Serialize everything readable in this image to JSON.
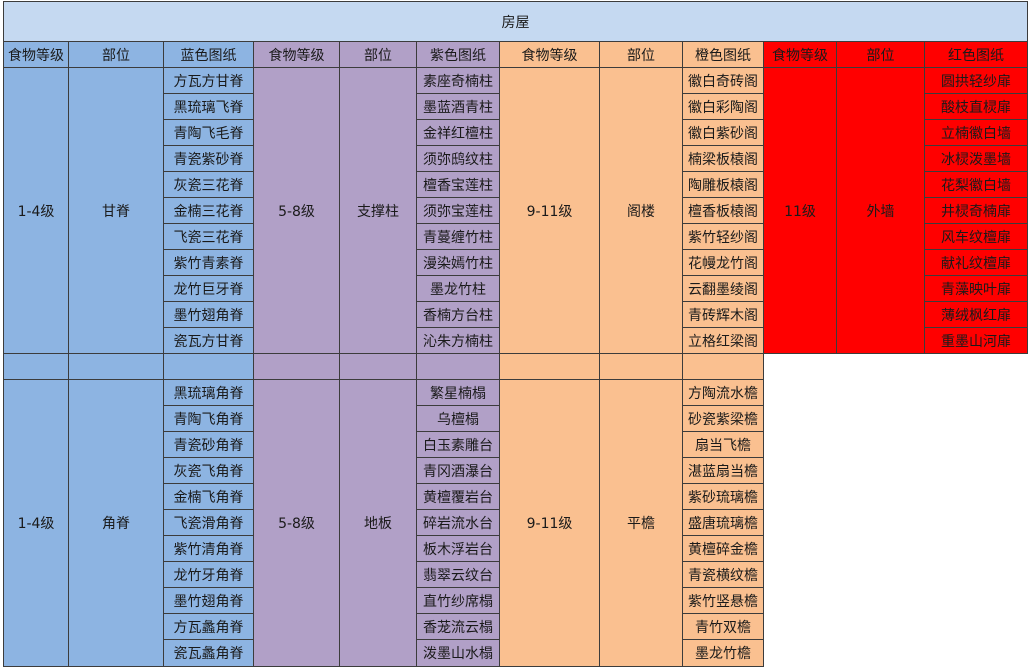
{
  "title": "房屋",
  "headers": [
    "食物等级",
    "部位",
    "蓝色图纸",
    "食物等级",
    "部位",
    "紫色图纸",
    "食物等级",
    "部位",
    "橙色图纸",
    "食物等级",
    "部位",
    "红色图纸"
  ],
  "group1": {
    "blue_level": "1-4级",
    "blue_part": "甘脊",
    "purple_level": "5-8级",
    "purple_part": "支撑柱",
    "orange_level": "9-11级",
    "orange_part": "阁楼",
    "red_level": "11级",
    "red_part": "外墙",
    "blue_items": [
      "方瓦方甘脊",
      "黑琉璃飞脊",
      "青陶飞毛脊",
      "青瓷紫砂脊",
      "灰瓷三花脊",
      "金楠三花脊",
      "飞瓷三花脊",
      "紫竹青素脊",
      "龙竹巨牙脊",
      "墨竹翅角脊",
      "瓷瓦方甘脊"
    ],
    "purple_items": [
      "素座奇楠柱",
      "墨蓝酒青柱",
      "金祥红檀柱",
      "须弥鸱纹柱",
      "檀香宝莲柱",
      "须弥宝莲柱",
      "青蔓缠竹柱",
      "漫染嫣竹柱",
      "墨龙竹柱",
      "香楠方台柱",
      "沁朱方楠柱"
    ],
    "orange_items": [
      "徽白奇砖阁",
      "徽白彩陶阁",
      "徽白紫砂阁",
      "楠梁板榬阁",
      "陶雕板榬阁",
      "檀香板榬阁",
      "紫竹轻纱阁",
      "花幔龙竹阁",
      "云翻墨绫阁",
      "青砖辉木阁",
      "立格红梁阁"
    ],
    "red_items": [
      "圆拱轻纱扉",
      "酸枝直棂扉",
      "立楠徽白墙",
      "冰棂泼墨墙",
      "花梨徽白墙",
      "井棂奇楠扉",
      "风车纹檀扉",
      "献礼纹檀扉",
      "青藻映叶扉",
      "薄绒枫红扉",
      "重墨山河扉"
    ]
  },
  "group2": {
    "blue_level": "1-4级",
    "blue_part": "角脊",
    "purple_level": "5-8级",
    "purple_part": "地板",
    "orange_level": "9-11级",
    "orange_part": "平檐",
    "blue_items": [
      "黑琉璃角脊",
      "青陶飞角脊",
      "青瓷砂角脊",
      "灰瓷飞角脊",
      "金楠飞角脊",
      "飞瓷滑角脊",
      "紫竹清角脊",
      "龙竹牙角脊",
      "墨竹翅角脊",
      "方瓦蠡角脊",
      "瓷瓦蠡角脊"
    ],
    "purple_items": [
      "繁星楠榻",
      "乌檀榻",
      "白玉素雕台",
      "青冈酒瀑台",
      "黄檀覆岩台",
      "碎岩流水台",
      "板木浮岩台",
      "翡翠云纹台",
      "直竹纱席榻",
      "香茏流云榻",
      "泼墨山水榻"
    ],
    "orange_items": [
      "方陶流水檐",
      "砂瓷紫梁檐",
      "扇当飞檐",
      "湛蓝扇当檐",
      "紫砂琉璃檐",
      "盛唐琉璃檐",
      "黄檀碎金檐",
      "青瓷横纹檐",
      "紫竹竖悬檐",
      "青竹双檐",
      "墨龙竹檐"
    ]
  }
}
